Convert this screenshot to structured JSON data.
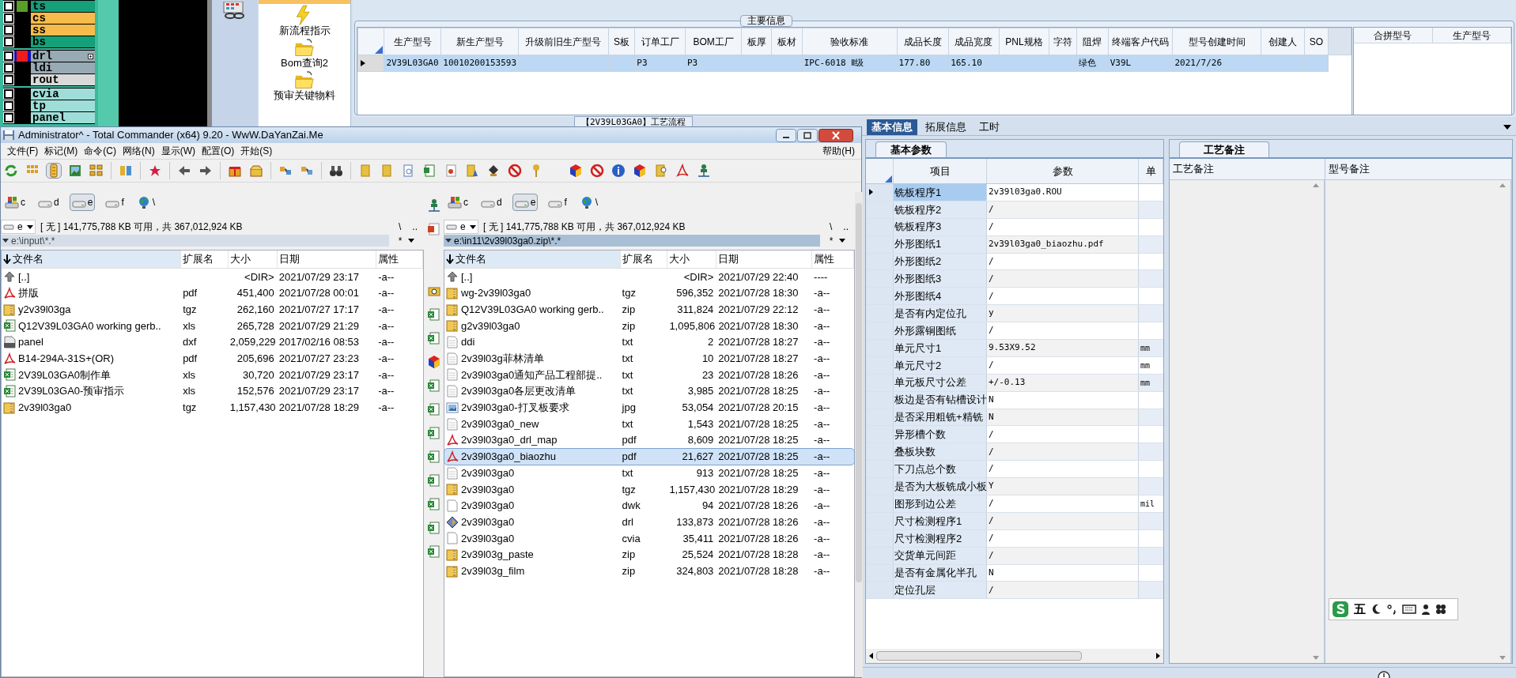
{
  "layer_panel": {
    "groups": [
      {
        "layers": [
          {
            "name": "ts",
            "color": "#14a078",
            "swatch": {
              "color": "#5a9e2a"
            },
            "selected": false,
            "expandable": false
          },
          {
            "name": "cs",
            "color": "#f7bb4b",
            "selected": false,
            "expandable": false
          },
          {
            "name": "ss",
            "color": "#f7bb4b",
            "selected": false,
            "expandable": false
          },
          {
            "name": "bs",
            "color": "#14a078",
            "selected": false,
            "expandable": false
          }
        ]
      },
      {
        "layers": [
          {
            "name": "drl",
            "color": "#98aab4",
            "swatch": {
              "color": "#ee1c1c"
            },
            "selected": true,
            "expandable": true
          },
          {
            "name": "ldi",
            "color": "#98aab4",
            "selected": false,
            "expandable": false
          },
          {
            "name": "rout",
            "color": "#d9d9d9",
            "selected": false,
            "expandable": false
          }
        ]
      },
      {
        "layers": [
          {
            "name": "cvia",
            "color": "#9fded8",
            "selected": false,
            "expandable": false
          },
          {
            "name": "tp",
            "color": "#9fded8",
            "selected": false,
            "expandable": false
          },
          {
            "name": "panel",
            "color": "#9fded8",
            "selected": false,
            "expandable": false
          }
        ]
      }
    ]
  },
  "nav_panel": {
    "items": [
      {
        "label": "新流程指示",
        "kind": "lightning"
      },
      {
        "label": "Bom查询2",
        "kind": "folder"
      },
      {
        "label": "预审关键物料",
        "kind": "folder"
      }
    ]
  },
  "main_info": {
    "title": "主要信息",
    "columns": [
      "生产型号",
      "新生产型号",
      "升级前旧生产型号",
      "S板",
      "订单工厂",
      "BOM工厂",
      "板厚",
      "板材",
      "验收标准",
      "成品长度",
      "成品宽度",
      "PNL规格",
      "字符",
      "阻焊",
      "终端客户代码",
      "型号创建时间",
      "创建人",
      "SO"
    ],
    "rows": [
      {
        "selected": true,
        "cells": [
          "2V39L03GA0",
          "10010200153593",
          "",
          "",
          "P3",
          "P3",
          "",
          "",
          "IPC-6018 Ⅱ级",
          "177.80",
          "165.10",
          "",
          "",
          "绿色",
          "V39L",
          "2021/7/26",
          "",
          ""
        ]
      }
    ],
    "merge_columns": [
      "合拼型号",
      "生产型号"
    ]
  },
  "process_tab": "【2V39L03GA0】工艺流程",
  "file_manager": {
    "title": "Administrator^ - Total Commander (x64) 9.20 - WwW.DaYanZai.Me",
    "menu": [
      "文件(F)",
      "标记(M)",
      "命令(C)",
      "网络(N)",
      "显示(W)",
      "配置(O)",
      "开始(S)"
    ],
    "help": "帮助(H)",
    "panels": [
      {
        "active": false,
        "drives": [
          {
            "label": "c",
            "kind": "system",
            "selected": false
          },
          {
            "label": "d",
            "kind": "disk",
            "selected": false
          },
          {
            "label": "e",
            "kind": "disk",
            "selected": true
          },
          {
            "label": "f",
            "kind": "disk",
            "selected": false
          },
          {
            "label": "\\",
            "kind": "network",
            "selected": false
          }
        ],
        "drive": "e",
        "free": "[ 无 ]  141,775,788 KB 可用，共 367,012,924 KB",
        "root": "\\",
        "up": "..",
        "path": "e:\\input\\*.*",
        "filter": "*",
        "columns": [
          "文件名",
          "扩展名",
          "大小",
          "日期",
          "属性"
        ],
        "rows": [
          {
            "name": "[..]",
            "ext": "",
            "size": "<DIR>",
            "date": "2021/07/29 23:17",
            "attr": "-a--",
            "kind": "up",
            "selected": false
          },
          {
            "name": "拼版",
            "ext": "pdf",
            "size": "451,400",
            "date": "2021/07/28 00:01",
            "attr": "-a--",
            "kind": "pdf",
            "selected": false
          },
          {
            "name": "y2v39l03ga",
            "ext": "tgz",
            "size": "262,160",
            "date": "2021/07/27 17:17",
            "attr": "-a--",
            "kind": "archive",
            "selected": false
          },
          {
            "name": "Q12V39L03GA0 working gerb..",
            "ext": "xls",
            "size": "265,728",
            "date": "2021/07/29 21:29",
            "attr": "-a--",
            "kind": "excel",
            "selected": false
          },
          {
            "name": "panel",
            "ext": "dxf",
            "size": "2,059,229",
            "date": "2017/02/16 08:53",
            "attr": "-a--",
            "kind": "cad",
            "selected": false
          },
          {
            "name": "B14-294A-31S+(OR)",
            "ext": "pdf",
            "size": "205,696",
            "date": "2021/07/27 23:23",
            "attr": "-a--",
            "kind": "pdf",
            "selected": false
          },
          {
            "name": "2V39L03GA0制作单",
            "ext": "xls",
            "size": "30,720",
            "date": "2021/07/29 23:17",
            "attr": "-a--",
            "kind": "excel",
            "selected": false
          },
          {
            "name": "2V39L03GA0-预审指示",
            "ext": "xls",
            "size": "152,576",
            "date": "2021/07/29 23:17",
            "attr": "-a--",
            "kind": "excel",
            "selected": false
          },
          {
            "name": "2v39l03ga0",
            "ext": "tgz",
            "size": "1,157,430",
            "date": "2021/07/28 18:29",
            "attr": "-a--",
            "kind": "archive",
            "selected": false
          }
        ]
      },
      {
        "active": true,
        "drives": [
          {
            "label": "c",
            "kind": "system",
            "selected": false
          },
          {
            "label": "d",
            "kind": "disk",
            "selected": false
          },
          {
            "label": "e",
            "kind": "disk",
            "selected": true
          },
          {
            "label": "f",
            "kind": "disk",
            "selected": false
          },
          {
            "label": "\\",
            "kind": "network",
            "selected": false
          }
        ],
        "drive": "e",
        "free": "[ 无 ]  141,775,788 KB 可用，共 367,012,924 KB",
        "root": "\\",
        "up": "..",
        "path": "e:\\in11\\2v39l03ga0.zip\\*.*",
        "filter": "*",
        "columns": [
          "文件名",
          "扩展名",
          "大小",
          "日期",
          "属性"
        ],
        "rows": [
          {
            "name": "[..]",
            "ext": "",
            "size": "<DIR>",
            "date": "2021/07/29 22:40",
            "attr": "----",
            "kind": "up",
            "selected": false
          },
          {
            "name": "wg-2v39l03ga0",
            "ext": "tgz",
            "size": "596,352",
            "date": "2021/07/28 18:30",
            "attr": "-a--",
            "kind": "archive",
            "selected": false
          },
          {
            "name": "Q12V39L03GA0 working gerb..",
            "ext": "zip",
            "size": "311,824",
            "date": "2021/07/29 22:12",
            "attr": "-a--",
            "kind": "archive",
            "selected": false
          },
          {
            "name": "g2v39l03ga0",
            "ext": "zip",
            "size": "1,095,806",
            "date": "2021/07/28 18:30",
            "attr": "-a--",
            "kind": "archive",
            "selected": false
          },
          {
            "name": "ddi",
            "ext": "txt",
            "size": "2",
            "date": "2021/07/28 18:27",
            "attr": "-a--",
            "kind": "text",
            "selected": false
          },
          {
            "name": "2v39l03g菲林清单",
            "ext": "txt",
            "size": "10",
            "date": "2021/07/28 18:27",
            "attr": "-a--",
            "kind": "text",
            "selected": false
          },
          {
            "name": "2v39l03ga0通知产品工程部提..",
            "ext": "txt",
            "size": "23",
            "date": "2021/07/28 18:26",
            "attr": "-a--",
            "kind": "text",
            "selected": false
          },
          {
            "name": "2v39l03ga0各层更改清单",
            "ext": "txt",
            "size": "3,985",
            "date": "2021/07/28 18:25",
            "attr": "-a--",
            "kind": "text",
            "selected": false
          },
          {
            "name": "2v39l03ga0-打叉板要求",
            "ext": "jpg",
            "size": "53,054",
            "date": "2021/07/28 20:15",
            "attr": "-a--",
            "kind": "image",
            "selected": false
          },
          {
            "name": "2v39l03ga0_new",
            "ext": "txt",
            "size": "1,543",
            "date": "2021/07/28 18:25",
            "attr": "-a--",
            "kind": "text",
            "selected": false
          },
          {
            "name": "2v39l03ga0_drl_map",
            "ext": "pdf",
            "size": "8,609",
            "date": "2021/07/28 18:25",
            "attr": "-a--",
            "kind": "pdf",
            "selected": false
          },
          {
            "name": "2v39l03ga0_biaozhu",
            "ext": "pdf",
            "size": "21,627",
            "date": "2021/07/28 18:25",
            "attr": "-a--",
            "kind": "pdf",
            "selected": true
          },
          {
            "name": "2v39l03ga0",
            "ext": "txt",
            "size": "913",
            "date": "2021/07/28 18:25",
            "attr": "-a--",
            "kind": "text",
            "selected": false
          },
          {
            "name": "2v39l03ga0",
            "ext": "tgz",
            "size": "1,157,430",
            "date": "2021/07/28 18:29",
            "attr": "-a--",
            "kind": "archive",
            "selected": false
          },
          {
            "name": "2v39l03ga0",
            "ext": "dwk",
            "size": "94",
            "date": "2021/07/28 18:26",
            "attr": "-a--",
            "kind": "blank",
            "selected": false
          },
          {
            "name": "2v39l03ga0",
            "ext": "drl",
            "size": "133,873",
            "date": "2021/07/28 18:26",
            "attr": "-a--",
            "kind": "drl",
            "selected": false
          },
          {
            "name": "2v39l03ga0",
            "ext": "cvia",
            "size": "35,411",
            "date": "2021/07/28 18:26",
            "attr": "-a--",
            "kind": "blank",
            "selected": false
          },
          {
            "name": "2v39l03g_paste",
            "ext": "zip",
            "size": "25,524",
            "date": "2021/07/28 18:28",
            "attr": "-a--",
            "kind": "archive",
            "selected": false
          },
          {
            "name": "2v39l03g_film",
            "ext": "zip",
            "size": "324,803",
            "date": "2021/07/28 18:28",
            "attr": "-a--",
            "kind": "archive",
            "selected": false
          }
        ]
      }
    ]
  },
  "detail": {
    "tabs": [
      {
        "label": "基本信息",
        "selected": true
      },
      {
        "label": "拓展信息",
        "selected": false
      },
      {
        "label": "工时",
        "selected": false
      }
    ],
    "params": {
      "title": "基本参数",
      "columns": [
        "项目",
        "参数",
        "单"
      ],
      "rows": [
        {
          "item": "铣板程序1",
          "value": "2v39l03ga0.ROU",
          "unit": "",
          "selected": true
        },
        {
          "item": "铣板程序2",
          "value": "/",
          "unit": "",
          "selected": false
        },
        {
          "item": "铣板程序3",
          "value": "/",
          "unit": "",
          "selected": false
        },
        {
          "item": "外形图纸1",
          "value": "2v39l03ga0_biaozhu.pdf",
          "unit": "",
          "selected": false
        },
        {
          "item": "外形图纸2",
          "value": "/",
          "unit": "",
          "selected": false
        },
        {
          "item": "外形图纸3",
          "value": "/",
          "unit": "",
          "selected": false
        },
        {
          "item": "外形图纸4",
          "value": "/",
          "unit": "",
          "selected": false
        },
        {
          "item": "是否有内定位孔",
          "value": "y",
          "unit": "",
          "selected": false
        },
        {
          "item": "外形露铜图纸",
          "value": "/",
          "unit": "",
          "selected": false
        },
        {
          "item": "单元尺寸1",
          "value": "9.53X9.52",
          "unit": "mm",
          "selected": false
        },
        {
          "item": "单元尺寸2",
          "value": "/",
          "unit": "mm",
          "selected": false
        },
        {
          "item": "单元板尺寸公差",
          "value": "+/-0.13",
          "unit": "mm",
          "selected": false
        },
        {
          "item": "板边是否有钻槽设计",
          "value": "N",
          "unit": "",
          "selected": false
        },
        {
          "item": "是否采用粗铣+精铣",
          "value": "N",
          "unit": "",
          "selected": false
        },
        {
          "item": "异形槽个数",
          "value": "/",
          "unit": "",
          "selected": false
        },
        {
          "item": "叠板块数",
          "value": "/",
          "unit": "",
          "selected": false
        },
        {
          "item": "下刀点总个数",
          "value": "/",
          "unit": "",
          "selected": false
        },
        {
          "item": "是否为大板铣成小板",
          "value": "Y",
          "unit": "",
          "selected": false
        },
        {
          "item": "图形到边公差",
          "value": "/",
          "unit": "mil",
          "selected": false
        },
        {
          "item": "尺寸检测程序1",
          "value": "/",
          "unit": "",
          "selected": false
        },
        {
          "item": "尺寸检测程序2",
          "value": "/",
          "unit": "",
          "selected": false
        },
        {
          "item": "交货单元间距",
          "value": "/",
          "unit": "",
          "selected": false
        },
        {
          "item": "是否有金属化半孔",
          "value": "N",
          "unit": "",
          "selected": false
        },
        {
          "item": "定位孔层",
          "value": "/",
          "unit": "",
          "selected": false
        }
      ]
    },
    "notes": {
      "title": "工艺备注",
      "columns": [
        "工艺备注",
        "型号备注"
      ]
    }
  },
  "ime": {
    "mode": "五"
  }
}
